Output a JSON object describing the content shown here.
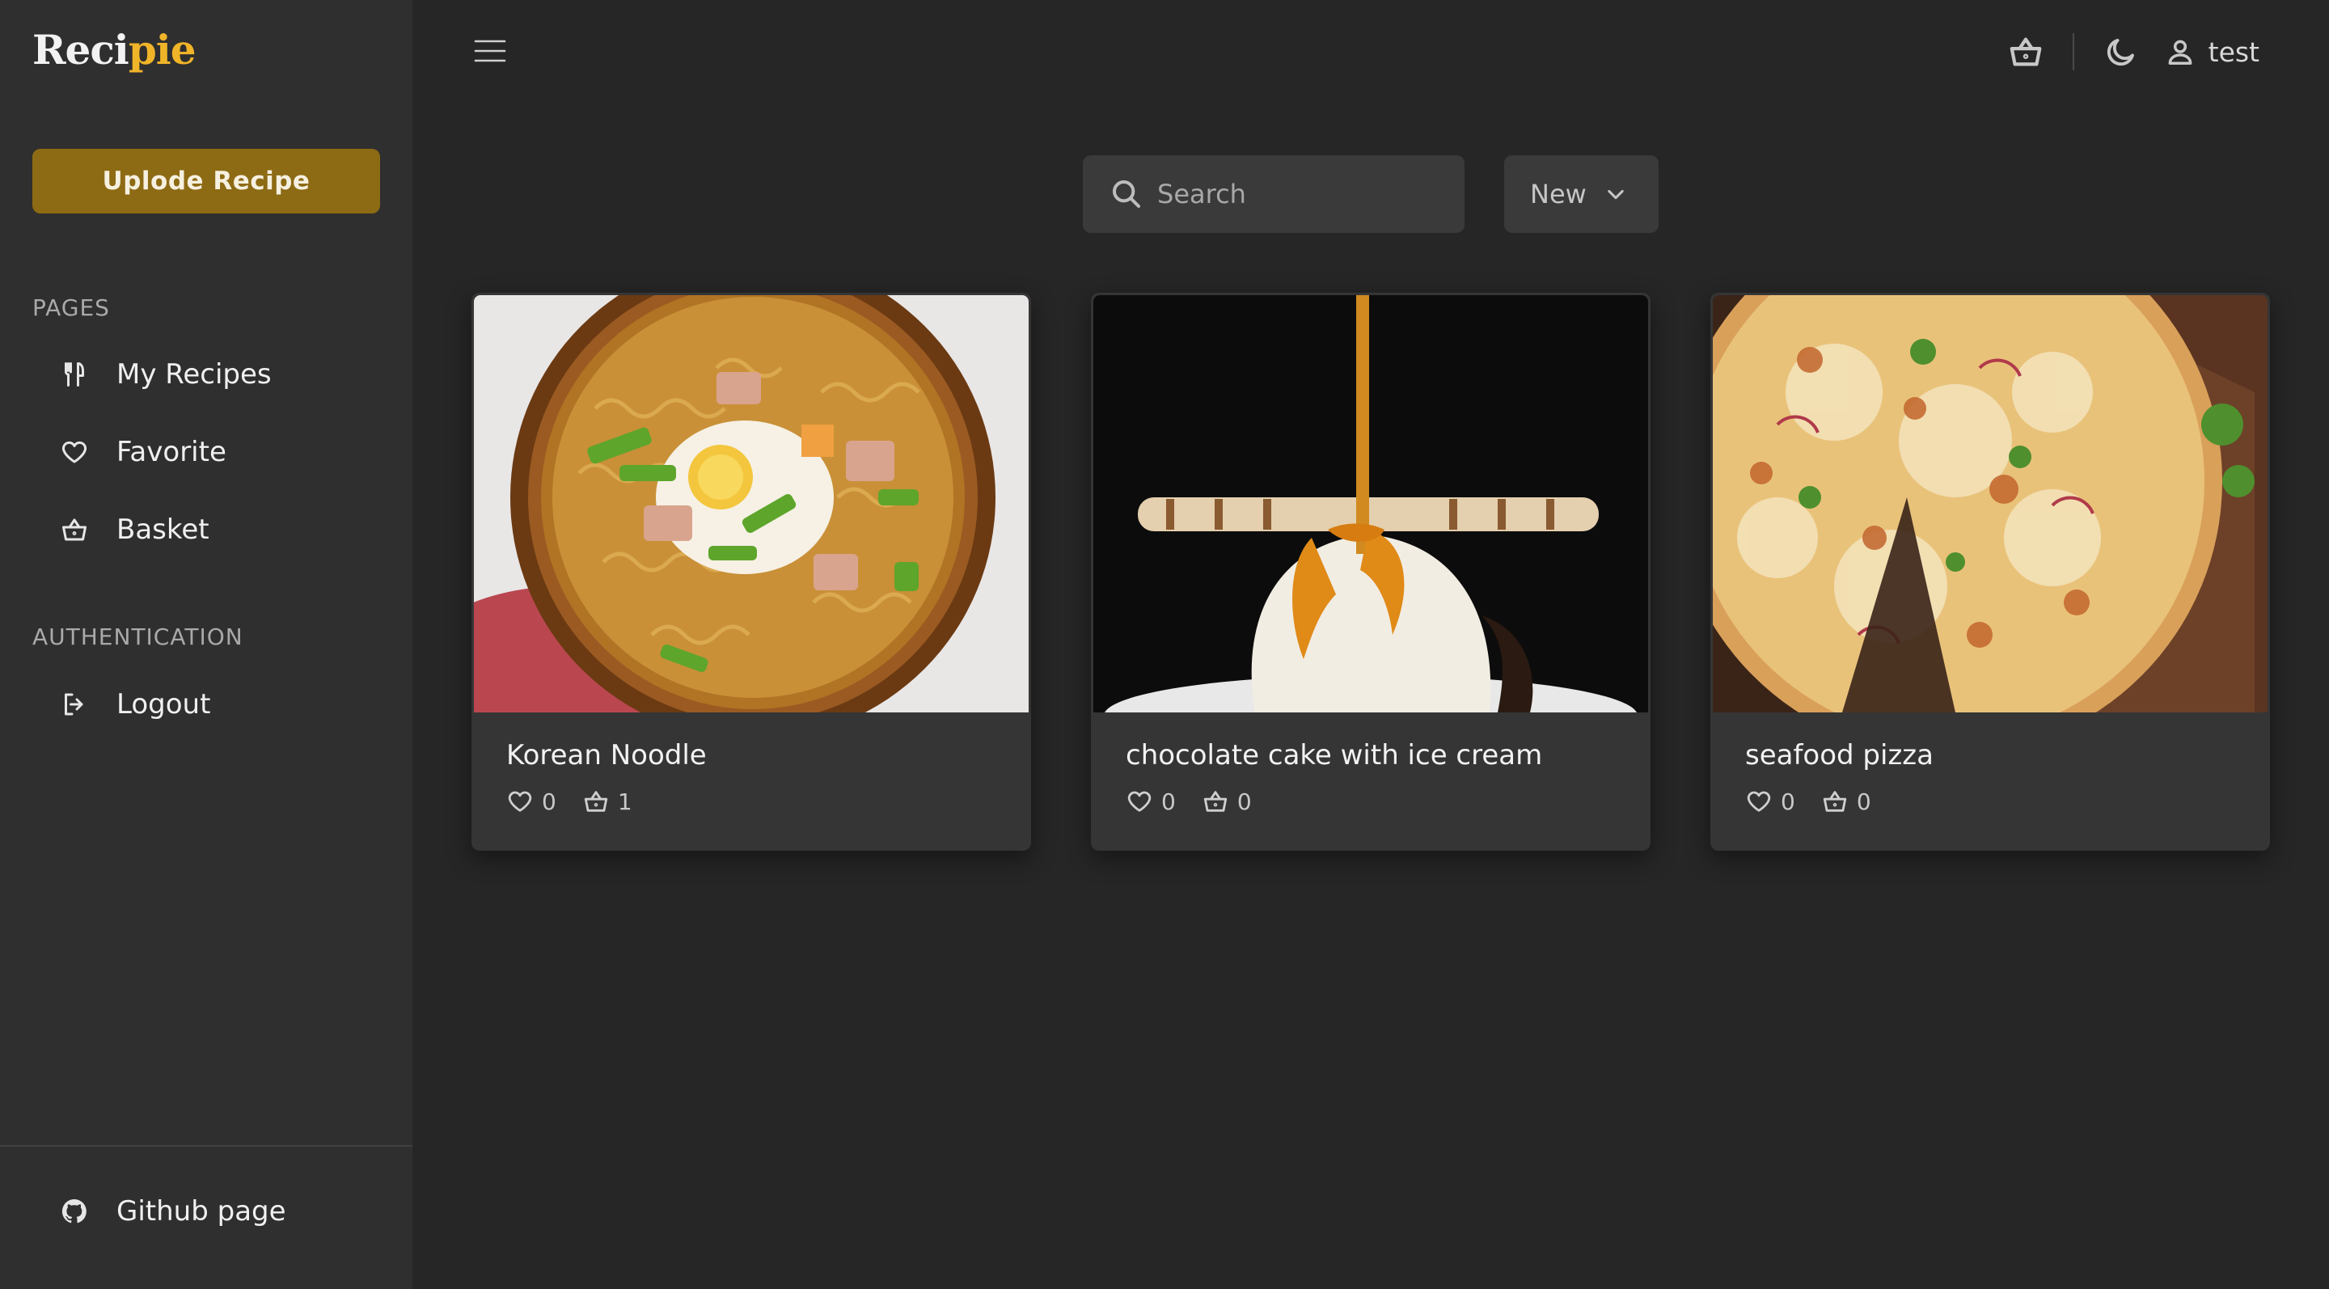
{
  "app": {
    "logo_part1": "Reci",
    "logo_part2": "pie",
    "brand_color": "#f0b429",
    "accent_button_color": "#8d6a14"
  },
  "sidebar": {
    "upload_label": "Uplode Recipe",
    "pages_title": "PAGES",
    "pages": [
      {
        "label": "My Recipes",
        "icon": "utensils-icon"
      },
      {
        "label": "Favorite",
        "icon": "heart-icon"
      },
      {
        "label": "Basket",
        "icon": "basket-icon"
      }
    ],
    "auth_title": "AUTHENTICATION",
    "auth": [
      {
        "label": "Logout",
        "icon": "logout-icon"
      }
    ],
    "footer": {
      "label": "Github page",
      "icon": "github-icon"
    }
  },
  "topbar": {
    "username": "test",
    "icons": [
      "menu-icon",
      "basket-icon",
      "moon-icon",
      "user-icon"
    ]
  },
  "filters": {
    "search_placeholder": "Search",
    "sort_value": "New"
  },
  "recipes": [
    {
      "title": "Korean Noodle",
      "likes": "0",
      "basket": "1"
    },
    {
      "title": "chocolate cake with ice cream",
      "likes": "0",
      "basket": "0"
    },
    {
      "title": "seafood pizza",
      "likes": "0",
      "basket": "0"
    }
  ]
}
